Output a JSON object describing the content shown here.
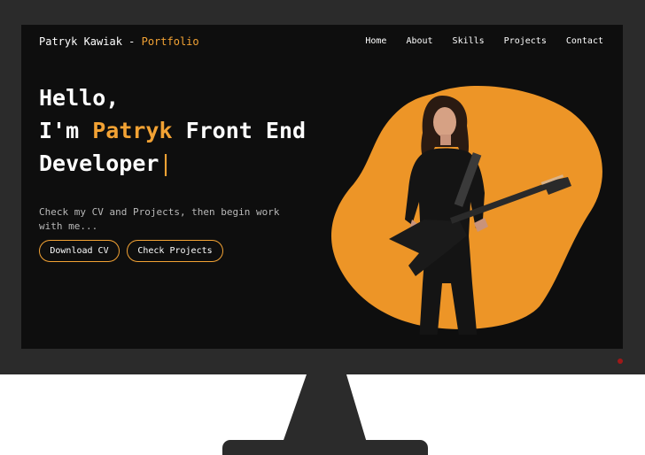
{
  "header": {
    "brand_name": "Patryk Kawiak - ",
    "brand_accent": "Portfolio"
  },
  "nav": {
    "items": [
      "Home",
      "About",
      "Skills",
      "Projects",
      "Contact"
    ]
  },
  "hero": {
    "greeting": "Hello,",
    "intro_prefix": "I'm ",
    "name": "Patryk",
    "role_line": " Front End",
    "role_line_2": "Developer",
    "cursor": "|",
    "tagline": "Check my CV and Projects, then begin work with me...",
    "download_button": "Download CV",
    "projects_button": "Check Projects"
  },
  "theme": {
    "accent": "#f2a234",
    "background": "#0e0e0e",
    "frame": "#2b2b2b"
  },
  "icons": {
    "hero_image": "guitarist-portrait-on-orange-blob"
  }
}
